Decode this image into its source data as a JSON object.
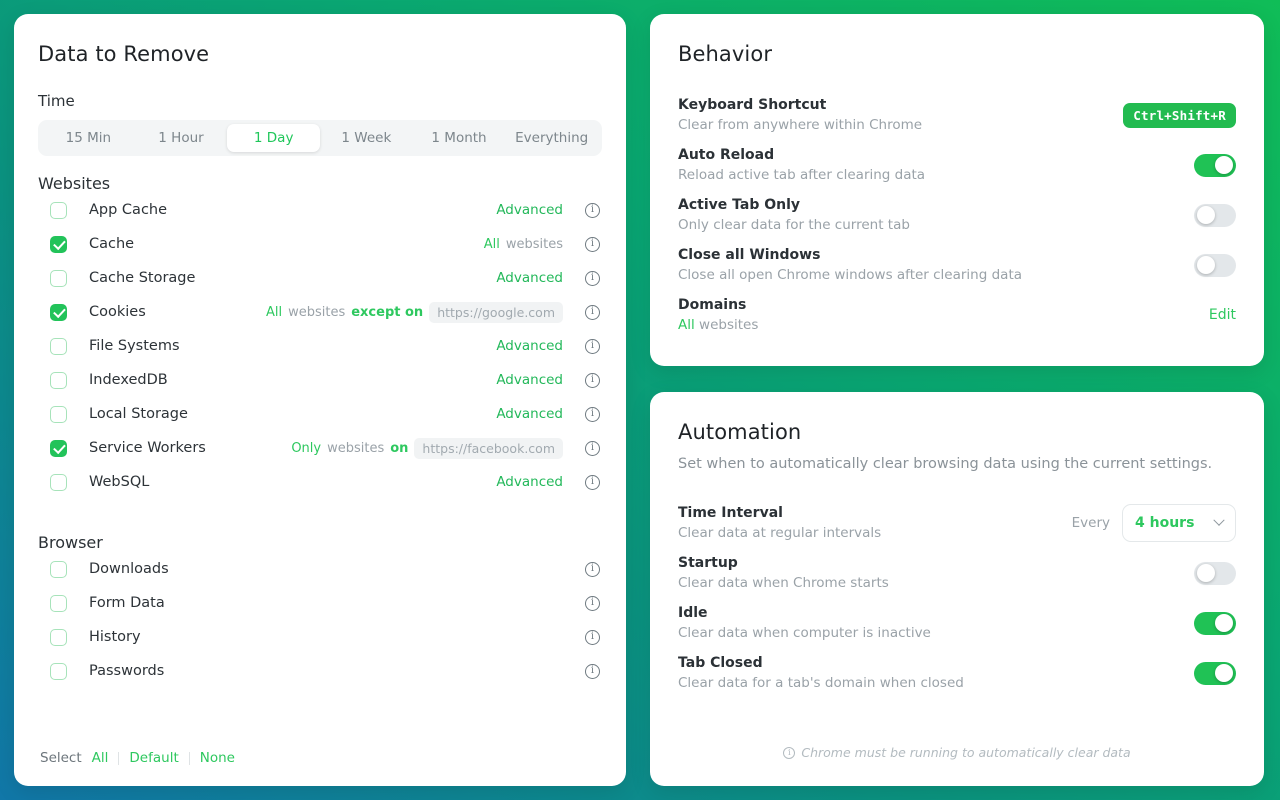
{
  "left_panel": {
    "title": "Data to Remove",
    "time": {
      "label": "Time",
      "options": [
        "15 Min",
        "1 Hour",
        "1 Day",
        "1 Week",
        "1 Month",
        "Everything"
      ],
      "selected": "1 Day"
    },
    "websites": {
      "label": "Websites",
      "items": [
        {
          "label": "App Cache",
          "checked": false,
          "meta_kind": "advanced",
          "advanced": "Advanced"
        },
        {
          "label": "Cache",
          "checked": true,
          "meta_kind": "scope",
          "scope": "All",
          "scope_suffix": "websites"
        },
        {
          "label": "Cache Storage",
          "checked": false,
          "meta_kind": "advanced",
          "advanced": "Advanced"
        },
        {
          "label": "Cookies",
          "checked": true,
          "meta_kind": "scope_chip",
          "scope": "All",
          "scope_suffix": "websites",
          "relation": "except on",
          "domain": "https://google.com"
        },
        {
          "label": "File Systems",
          "checked": false,
          "meta_kind": "advanced",
          "advanced": "Advanced"
        },
        {
          "label": "IndexedDB",
          "checked": false,
          "meta_kind": "advanced",
          "advanced": "Advanced"
        },
        {
          "label": "Local Storage",
          "checked": false,
          "meta_kind": "advanced",
          "advanced": "Advanced"
        },
        {
          "label": "Service Workers",
          "checked": true,
          "meta_kind": "scope_chip",
          "scope": "Only",
          "scope_suffix": "websites",
          "relation": "on",
          "domain": "https://facebook.com"
        },
        {
          "label": "WebSQL",
          "checked": false,
          "meta_kind": "advanced",
          "advanced": "Advanced"
        }
      ]
    },
    "browser": {
      "label": "Browser",
      "items": [
        {
          "label": "Downloads",
          "checked": false
        },
        {
          "label": "Form Data",
          "checked": false
        },
        {
          "label": "History",
          "checked": false
        },
        {
          "label": "Passwords",
          "checked": false
        }
      ]
    },
    "footer": {
      "select_label": "Select",
      "all": "All",
      "default": "Default",
      "none": "None"
    }
  },
  "behavior_panel": {
    "title": "Behavior",
    "items": [
      {
        "title": "Keyboard Shortcut",
        "desc": "Clear from anywhere within Chrome",
        "control": "kbd",
        "kbd": "Ctrl+Shift+R"
      },
      {
        "title": "Auto Reload",
        "desc": "Reload active tab after clearing data",
        "control": "toggle",
        "on": true
      },
      {
        "title": "Active Tab Only",
        "desc": "Only clear data for the current tab",
        "control": "toggle",
        "on": false
      },
      {
        "title": "Close all Windows",
        "desc": "Close all open Chrome windows after clearing data",
        "control": "toggle",
        "on": false
      },
      {
        "title": "Domains",
        "desc_accent": "All",
        "desc": "websites",
        "control": "link",
        "link": "Edit"
      }
    ]
  },
  "automation_panel": {
    "title": "Automation",
    "subtitle": "Set when to automatically clear browsing data using the current settings.",
    "items": [
      {
        "title": "Time Interval",
        "desc": "Clear data at regular intervals",
        "control": "select",
        "every_label": "Every",
        "value": "4 hours"
      },
      {
        "title": "Startup",
        "desc": "Clear data when Chrome starts",
        "control": "toggle",
        "on": false
      },
      {
        "title": "Idle",
        "desc": "Clear data when computer is inactive",
        "control": "toggle",
        "on": true
      },
      {
        "title": "Tab Closed",
        "desc": "Clear data for a tab's domain when closed",
        "control": "toggle",
        "on": true
      }
    ],
    "note": "Chrome must be running to automatically clear data"
  },
  "icons": {
    "info": "i",
    "note_info": "i"
  },
  "colors": {
    "accent_green": "#2ec85f",
    "brand_green": "#22c35a",
    "gradient_start": "#10bd57",
    "gradient_end": "#1177a8"
  }
}
